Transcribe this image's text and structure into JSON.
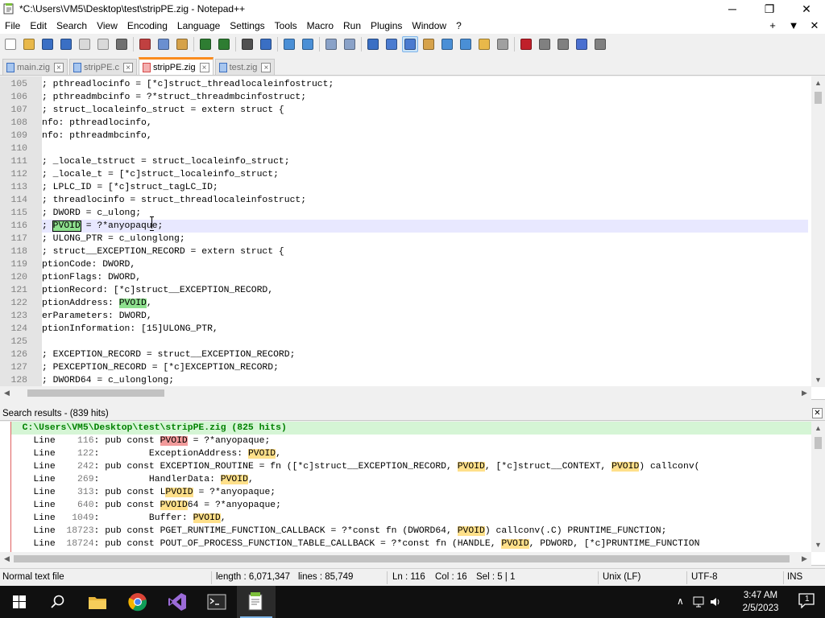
{
  "window": {
    "title": "*C:\\Users\\VM5\\Desktop\\test\\stripPE.zig - Notepad++",
    "minimize": "─",
    "maximize": "❐",
    "close": "✕"
  },
  "menu": {
    "items": [
      "File",
      "Edit",
      "Search",
      "View",
      "Encoding",
      "Language",
      "Settings",
      "Tools",
      "Macro",
      "Run",
      "Plugins",
      "Window",
      "?"
    ],
    "right": [
      "+",
      "▼",
      "✕"
    ]
  },
  "toolbar": {
    "icons": [
      "new-file-icon",
      "open-file-icon",
      "save-icon",
      "save-all-icon",
      "close-icon",
      "close-all-icon",
      "print-icon",
      "cut-icon",
      "copy-icon",
      "paste-icon",
      "undo-icon",
      "redo-icon",
      "find-icon",
      "replace-icon",
      "zoom-in-icon",
      "zoom-out-icon",
      "sync-vertical-icon",
      "sync-horizontal-icon",
      "word-wrap-icon",
      "show-all-chars-icon",
      "indent-guide-icon",
      "user-language-icon",
      "doc-map-icon",
      "function-list-icon",
      "folder-workspace-icon",
      "monitoring-icon",
      "record-macro-icon",
      "stop-macro-icon",
      "play-macro-icon",
      "play-macro-multiple-icon",
      "save-macro-icon"
    ],
    "active_index": 20,
    "icon_colors": [
      "#ffffff",
      "#e8b84a",
      "#3a6fc4",
      "#3a6fc4",
      "#d9d9d9",
      "#d9d9d9",
      "#707070",
      "#c04040",
      "#6a8fd0",
      "#d6a24a",
      "#2e7d32",
      "#2e7d32",
      "#505050",
      "#3a6fc4",
      "#4a8fd6",
      "#4a8fd6",
      "#8aa2c8",
      "#8aa2c8",
      "#3a6fc4",
      "#4a7bd0",
      "#4a7bd0",
      "#d6a24a",
      "#4a8fd6",
      "#4a8fd6",
      "#e8b84a",
      "#a0a0a0",
      "#c0202a",
      "#808080",
      "#808080",
      "#4a6fd0",
      "#808080"
    ]
  },
  "tabs": [
    {
      "label": "main.zig",
      "active": false
    },
    {
      "label": "stripPE.c",
      "active": false
    },
    {
      "label": "stripPE.zig",
      "active": true
    },
    {
      "label": "test.zig",
      "active": false
    }
  ],
  "editor": {
    "lines": [
      {
        "n": "105",
        "text": "; pthreadlocinfo = [*c]struct_threadlocaleinfostruct;"
      },
      {
        "n": "106",
        "text": "; pthreadmbcinfo = ?*struct_threadmbcinfostruct;"
      },
      {
        "n": "107",
        "text": "; struct_localeinfo_struct = extern struct {"
      },
      {
        "n": "108",
        "text": "nfo: pthreadlocinfo,"
      },
      {
        "n": "109",
        "text": "nfo: pthreadmbcinfo,"
      },
      {
        "n": "110",
        "text": ""
      },
      {
        "n": "111",
        "text": "; _locale_tstruct = struct_localeinfo_struct;"
      },
      {
        "n": "112",
        "text": "; _locale_t = [*c]struct_localeinfo_struct;"
      },
      {
        "n": "113",
        "text": "; LPLC_ID = [*c]struct_tagLC_ID;"
      },
      {
        "n": "114",
        "text": "; threadlocinfo = struct_threadlocaleinfostruct;"
      },
      {
        "n": "115",
        "text": "; DWORD = c_ulong;"
      },
      {
        "n": "116",
        "text": "; PVOID = ?*anyopaque;"
      },
      {
        "n": "117",
        "text": "; ULONG_PTR = c_ulonglong;"
      },
      {
        "n": "118",
        "text": "; struct__EXCEPTION_RECORD = extern struct {"
      },
      {
        "n": "119",
        "text": "ptionCode: DWORD,"
      },
      {
        "n": "120",
        "text": "ptionFlags: DWORD,"
      },
      {
        "n": "121",
        "text": "ptionRecord: [*c]struct__EXCEPTION_RECORD,"
      },
      {
        "n": "122",
        "text": "ptionAddress: PVOID,"
      },
      {
        "n": "123",
        "text": "erParameters: DWORD,"
      },
      {
        "n": "124",
        "text": "ptionInformation: [15]ULONG_PTR,"
      },
      {
        "n": "125",
        "text": ""
      },
      {
        "n": "126",
        "text": "; EXCEPTION_RECORD = struct__EXCEPTION_RECORD;"
      },
      {
        "n": "127",
        "text": "; PEXCEPTION_RECORD = [*c]EXCEPTION_RECORD;"
      },
      {
        "n": "128",
        "text": "; DWORD64 = c_ulonglong;"
      }
    ],
    "current_line_index": 11,
    "highlight_word": "PVOID"
  },
  "search_results": {
    "header": "Search results - (839 hits)",
    "close": "✕",
    "file_line": "C:\\Users\\VM5\\Desktop\\test\\stripPE.zig (825 hits)",
    "line_label": "Line",
    "results": [
      {
        "no": "116",
        "pre": "pub const ",
        "hit": "PVOID",
        "post": " = ?*anyopaque;",
        "first": true
      },
      {
        "no": "122",
        "pre": "        ExceptionAddress: ",
        "hit": "PVOID",
        "post": ",",
        "first": false
      },
      {
        "no": "242",
        "pre": "pub const EXCEPTION_ROUTINE = fn ([*c]struct__EXCEPTION_RECORD, ",
        "hit": "PVOID",
        "post": ", [*c]struct__CONTEXT, ",
        "hit2": "PVOID",
        "post2": ") callconv(",
        "first": false
      },
      {
        "no": "269",
        "pre": "        HandlerData: ",
        "hit": "PVOID",
        "post": ",",
        "first": false
      },
      {
        "no": "313",
        "pre": "pub const L",
        "hit": "PVOID",
        "post": " = ?*anyopaque;",
        "first": false
      },
      {
        "no": "640",
        "pre": "pub const ",
        "hit": "PVOID",
        "post": "64 = ?*anyopaque;",
        "first": false
      },
      {
        "no": "1049",
        "pre": "        Buffer: ",
        "hit": "PVOID",
        "post": ",",
        "first": false
      },
      {
        "no": "18723",
        "pre": "pub const PGET_RUNTIME_FUNCTION_CALLBACK = ?*const fn (DWORD64, ",
        "hit": "PVOID",
        "post": ") callconv(.C) PRUNTIME_FUNCTION;",
        "first": false
      },
      {
        "no": "18724",
        "pre": "pub const POUT_OF_PROCESS_FUNCTION_TABLE_CALLBACK = ?*const fn (HANDLE, ",
        "hit": "PVOID",
        "post": ", PDWORD, [*c]PRUNTIME_FUNCTION",
        "first": false
      }
    ]
  },
  "status": {
    "type": "Normal text file",
    "length": "length : 6,071,347",
    "lines": "lines : 85,749",
    "ln": "Ln : 116",
    "col": "Col : 16",
    "sel": "Sel : 5 | 1",
    "eol": "Unix (LF)",
    "encoding": "UTF-8",
    "mode": "INS"
  },
  "taskbar": {
    "apps": [
      "start-button",
      "search-icon",
      "file-explorer-icon",
      "chrome-icon",
      "visual-studio-icon",
      "terminal-icon",
      "notepad-plus-plus-icon"
    ],
    "active_app": "notepad-plus-plus-icon",
    "time": "3:47 AM",
    "date": "2/5/2023",
    "notifications": "1"
  }
}
